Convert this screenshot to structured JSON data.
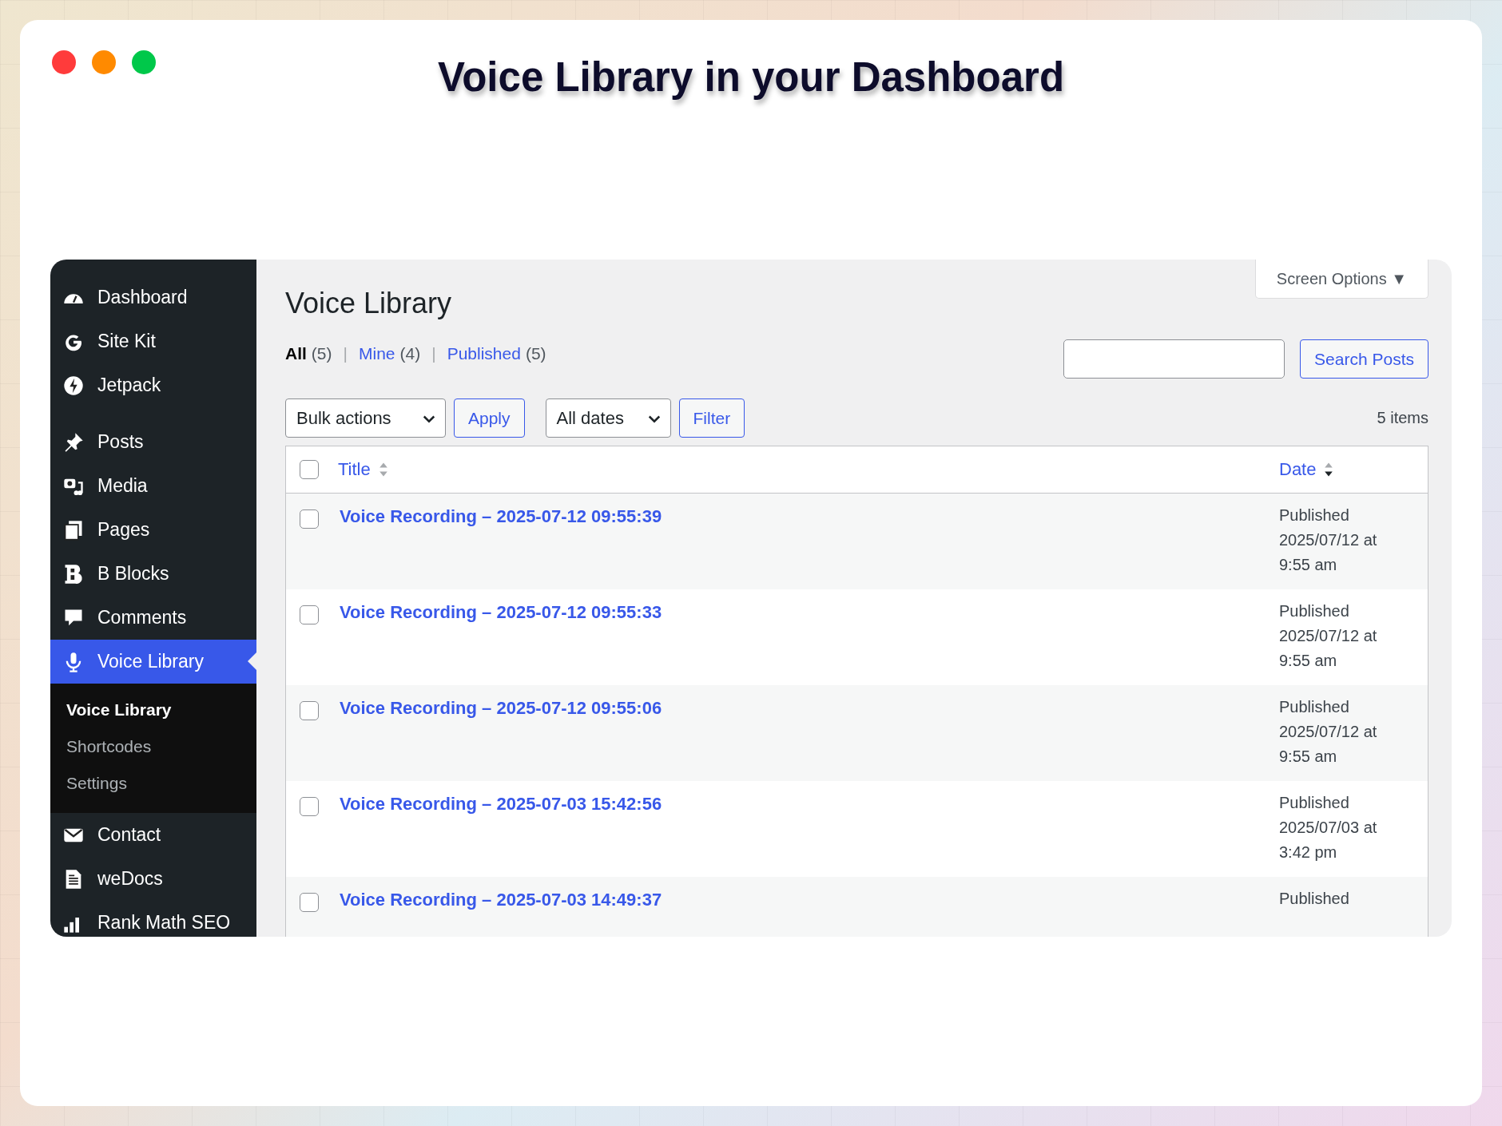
{
  "window": {
    "title": "Voice Library in your Dashboard",
    "controls": [
      {
        "color": "#ff3b3b"
      },
      {
        "color": "#ff8a00"
      },
      {
        "color": "#00c84a"
      }
    ]
  },
  "sidebar": {
    "sections": [
      {
        "items": [
          {
            "label": "Dashboard",
            "selected": false
          },
          {
            "label": "Site Kit",
            "selected": false
          },
          {
            "label": "Jetpack",
            "selected": false
          }
        ]
      },
      {
        "items": [
          {
            "label": "Posts",
            "selected": false
          },
          {
            "label": "Media",
            "selected": false
          },
          {
            "label": "Pages",
            "selected": false
          },
          {
            "label": "B Blocks",
            "selected": false
          },
          {
            "label": "Comments",
            "selected": false
          },
          {
            "label": "Voice Library",
            "selected": true,
            "children": [
              {
                "label": "Voice Library",
                "selected": true
              },
              {
                "label": "Shortcodes",
                "selected": false
              },
              {
                "label": "Settings",
                "selected": false
              }
            ]
          },
          {
            "label": "Contact",
            "selected": false
          },
          {
            "label": "weDocs",
            "selected": false
          },
          {
            "label": "Rank Math SEO",
            "selected": false
          }
        ]
      }
    ]
  },
  "main": {
    "page_title": "Voice Library",
    "screen_options": "Screen Options ▼",
    "views": [
      {
        "label": "All",
        "count": "(5)",
        "selected": true
      },
      {
        "separator": "|",
        "label": "Mine",
        "count": "(4)",
        "selected": false
      },
      {
        "separator": "|",
        "label": "Published",
        "count": "(5)",
        "selected": false
      }
    ],
    "search": {
      "button": "Search Posts"
    },
    "bulk_actions": "Bulk actions",
    "apply": "Apply",
    "dates": "All dates",
    "filter": "Filter",
    "items_count": "5 items",
    "table": {
      "select_all_checked": false,
      "columns": [
        {
          "label": "Title",
          "sorted": false
        },
        {
          "label": "Date",
          "sorted": true
        }
      ],
      "rows": [
        {
          "title": "Voice Recording – 2025-07-12 09:55:39",
          "status": "Published",
          "date": "2025/07/12 at",
          "time": "9:55 am",
          "checked": false
        },
        {
          "title": "Voice Recording – 2025-07-12 09:55:33",
          "status": "Published",
          "date": "2025/07/12 at",
          "time": "9:55 am",
          "checked": false
        },
        {
          "title": "Voice Recording – 2025-07-12 09:55:06",
          "status": "Published",
          "date": "2025/07/12 at",
          "time": "9:55 am",
          "checked": false
        },
        {
          "title": "Voice Recording – 2025-07-03 15:42:56",
          "status": "Published",
          "date": "2025/07/03 at",
          "time": "3:42 pm",
          "checked": false
        },
        {
          "title": "Voice Recording – 2025-07-03 14:49:37",
          "status": "Published",
          "checked": false
        }
      ]
    }
  }
}
